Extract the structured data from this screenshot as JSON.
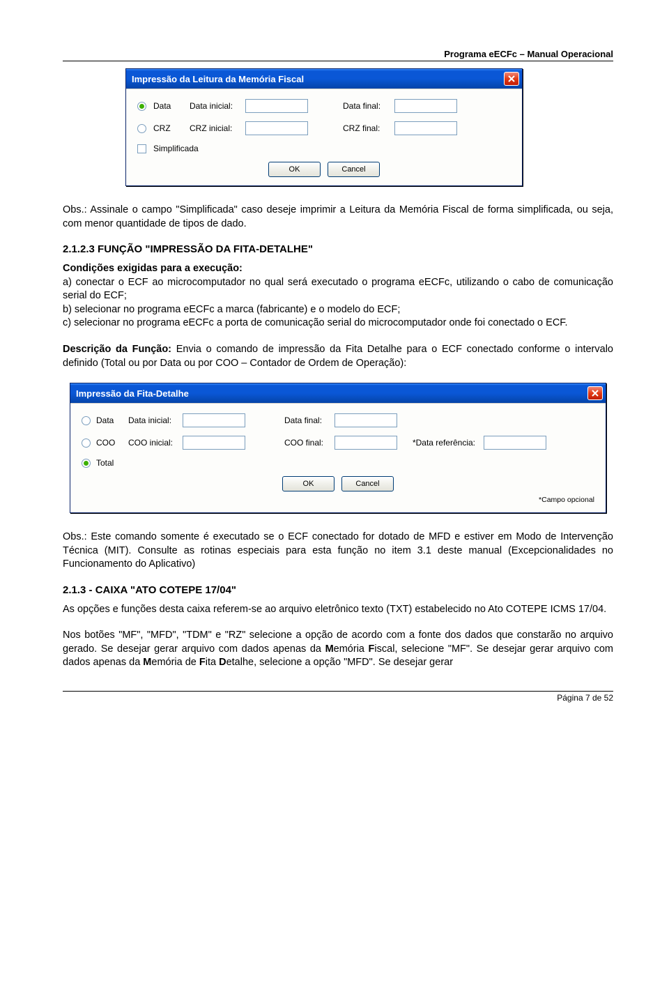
{
  "header": {
    "title": "Programa eECFc – Manual Operacional"
  },
  "dialog1": {
    "title": "Impressão da Leitura da Memória Fiscal",
    "row1": {
      "radio_label": "Data",
      "label_left": "Data inicial:",
      "label_right": "Data final:"
    },
    "row2": {
      "radio_label": "CRZ",
      "label_left": "CRZ inicial:",
      "label_right": "CRZ final:"
    },
    "check_label": "Simplificada",
    "ok": "OK",
    "cancel": "Cancel"
  },
  "para1": "Obs.: Assinale o campo \"Simplificada\" caso deseje imprimir a Leitura da Memória Fiscal de forma simplificada, ou seja, com menor quantidade de tipos de dado.",
  "sec1": {
    "heading": "2.1.2.3 FUNÇÃO \"IMPRESSÃO DA FITA-DETALHE\""
  },
  "para2_label": "Condições exigidas para a execução:",
  "para2": "a) conectar o ECF ao microcomputador no qual será executado o programa eECFc, utilizando o cabo de comunicação serial do ECF;\nb) selecionar no programa eECFc a marca (fabricante) e o modelo do ECF;\nc) selecionar no programa eECFc a porta de comunicação serial do microcomputador onde foi conectado o ECF.",
  "para3_label": "Descrição da Função:",
  "para3": " Envia o comando de impressão da Fita Detalhe para o ECF conectado conforme o intervalo definido (Total ou por Data ou por COO – Contador de Ordem de Operação):",
  "dialog2": {
    "title": "Impressão da Fita-Detalhe",
    "row1": {
      "radio_label": "Data",
      "label_left": "Data inicial:",
      "label_right": "Data final:"
    },
    "row2": {
      "radio_label": "COO",
      "label_left": "COO inicial:",
      "label_right": "COO final:",
      "ref_label": "*Data referência:"
    },
    "row3": {
      "radio_label": "Total"
    },
    "ok": "OK",
    "cancel": "Cancel",
    "optional": "*Campo opcional"
  },
  "para4": "Obs.: Este comando somente é executado se o ECF conectado for dotado de MFD e estiver em Modo de Intervenção Técnica (MIT). Consulte as rotinas especiais para esta função no item 3.1 deste manual (Excepcionalidades no Funcionamento do Aplicativo)",
  "sec2": {
    "heading": "2.1.3 - CAIXA \"ATO COTEPE 17/04\""
  },
  "para5": "As opções e funções desta caixa referem-se ao arquivo eletrônico texto (TXT) estabelecido no Ato COTEPE ICMS 17/04.",
  "para6_a": "Nos botões \"MF\", \"MFD\", \"TDM\" e \"RZ\" selecione a opção de acordo com a fonte dos dados que constarão no arquivo gerado. Se desejar gerar arquivo com dados apenas da ",
  "para6_b": "emória ",
  "para6_c": "iscal, selecione \"MF\". Se desejar gerar arquivo com dados apenas da ",
  "para6_d": "emória de ",
  "para6_e": "ita ",
  "para6_f": "etalhe, selecione a opção \"MFD\". Se desejar gerar",
  "bold": {
    "M1": "M",
    "F1": "F",
    "M2": "M",
    "F2": "F",
    "D1": "D"
  },
  "footer": {
    "page": "Página 7 de 52"
  }
}
